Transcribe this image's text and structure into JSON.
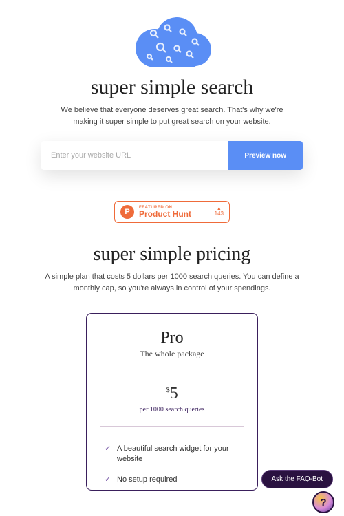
{
  "hero": {
    "title": "super simple search",
    "subtitle": "We believe that everyone deserves great search. That's why we're making it super simple to put great search on your website.",
    "input_placeholder": "Enter your website URL",
    "button_label": "Preview now"
  },
  "product_hunt": {
    "featured_label": "FEATURED ON",
    "name": "Product Hunt",
    "upvotes": "143"
  },
  "pricing": {
    "title": "super simple pricing",
    "subtitle": "A simple plan that costs 5 dollars per 1000 search queries. You can define a monthly cap, so you're always in control of your spendings.",
    "plan": {
      "name": "Pro",
      "tagline": "The whole package",
      "currency": "$",
      "amount": "5",
      "unit": "per 1000 search queries",
      "features": [
        "A beautiful search widget for your website",
        "No setup required"
      ]
    }
  },
  "faq": {
    "button_label": "Ask the FAQ-Bot",
    "icon_glyph": "?"
  }
}
